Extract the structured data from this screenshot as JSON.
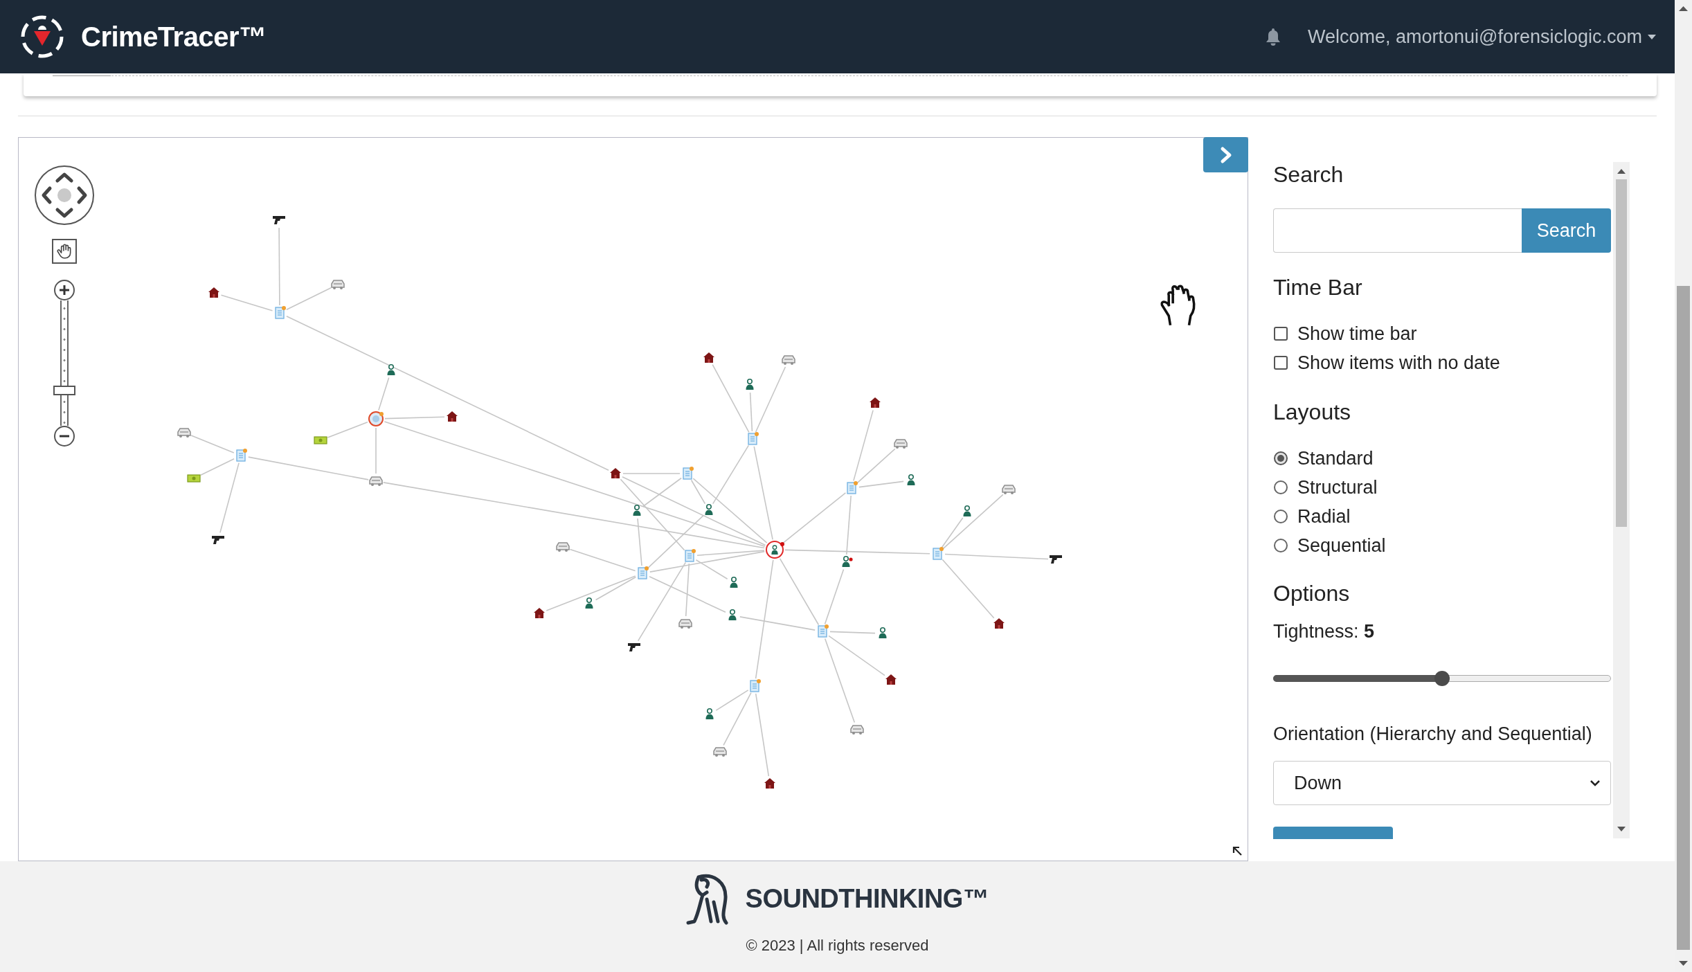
{
  "header": {
    "brand": "CrimeTracer™",
    "user_menu": "Welcome, amortonui@forensiclogic.com"
  },
  "graph": {
    "zoom_slider": {
      "level": 0.28
    }
  },
  "side_panel": {
    "search": {
      "heading": "Search",
      "button": "Search"
    },
    "time_bar": {
      "heading": "Time Bar",
      "options": [
        {
          "label": "Show time bar",
          "checked": false
        },
        {
          "label": "Show items with no date",
          "checked": false
        }
      ]
    },
    "layouts": {
      "heading": "Layouts",
      "options": [
        {
          "label": "Standard",
          "selected": true
        },
        {
          "label": "Structural",
          "selected": false
        },
        {
          "label": "Radial",
          "selected": false
        },
        {
          "label": "Sequential",
          "selected": false
        }
      ]
    },
    "options": {
      "heading": "Options",
      "tightness": {
        "label": "Tightness: **5**",
        "level": 0.5
      },
      "orientation": {
        "label": "Orientation (Hierarchy and Sequential)",
        "value": "Down"
      }
    }
  },
  "footer": {
    "logo": "SOUNDTHINKING™",
    "copyright": "© 2023 | All rights reserved"
  }
}
